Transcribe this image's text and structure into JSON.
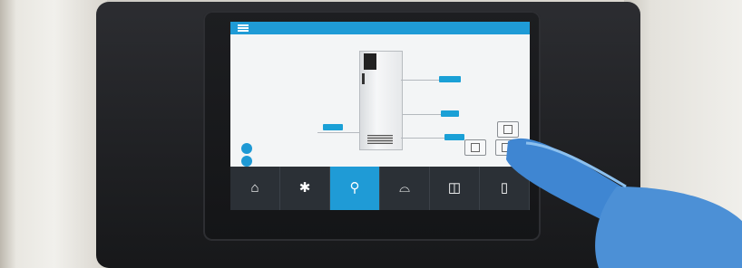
{
  "scene": {
    "description_free": true
  },
  "screen": {
    "active_tab": "search",
    "nav": [
      {
        "id": "home",
        "icon": "home-icon"
      },
      {
        "id": "settings",
        "icon": "gear-icon"
      },
      {
        "id": "search",
        "icon": "search-icon"
      },
      {
        "id": "inbox",
        "icon": "tray-icon"
      },
      {
        "id": "manual",
        "icon": "book-icon"
      },
      {
        "id": "extra",
        "icon": "device-icon"
      }
    ]
  },
  "colors": {
    "accent": "#1f9bd6",
    "navbar": "#2b3036",
    "glove": "#4c90d6"
  }
}
